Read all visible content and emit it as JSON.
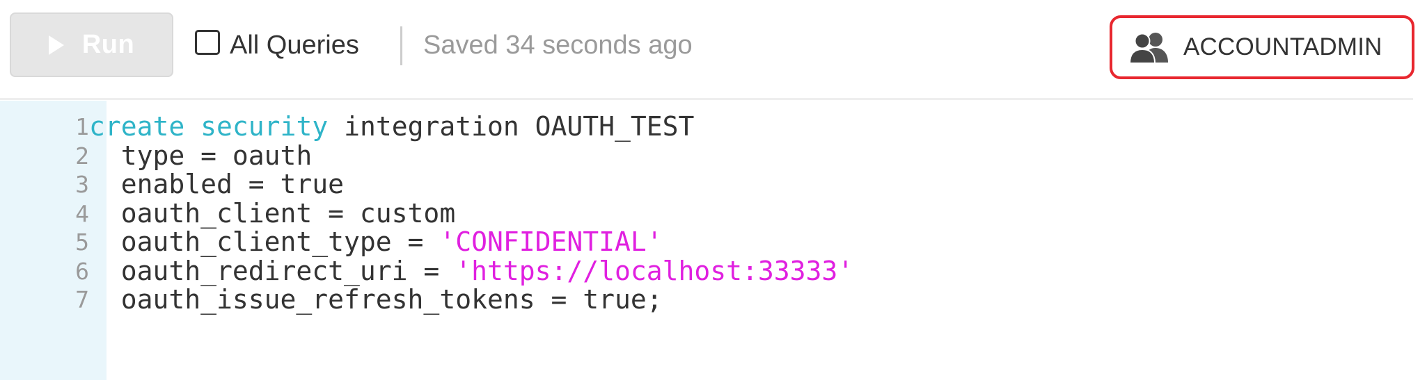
{
  "toolbar": {
    "run_label": "Run",
    "all_queries_label": "All Queries",
    "all_queries_checked": false,
    "saved_status": "Saved 34 seconds ago",
    "role_label": "ACCOUNTADMIN",
    "role_icon": "users-icon",
    "run_icon": "play-icon"
  },
  "editor": {
    "lines": [
      {
        "number": "1",
        "tokens": [
          {
            "text": "create",
            "kind": "keyword"
          },
          {
            "text": " ",
            "kind": "plain"
          },
          {
            "text": "security",
            "kind": "keyword"
          },
          {
            "text": " integration OAUTH_TEST",
            "kind": "plain"
          }
        ]
      },
      {
        "number": "2",
        "tokens": [
          {
            "text": "  type = oauth",
            "kind": "plain"
          }
        ]
      },
      {
        "number": "3",
        "tokens": [
          {
            "text": "  enabled = true",
            "kind": "plain"
          }
        ]
      },
      {
        "number": "4",
        "tokens": [
          {
            "text": "  oauth_client = custom",
            "kind": "plain"
          }
        ]
      },
      {
        "number": "5",
        "tokens": [
          {
            "text": "  oauth_client_type = ",
            "kind": "plain"
          },
          {
            "text": "'CONFIDENTIAL'",
            "kind": "string"
          }
        ]
      },
      {
        "number": "6",
        "tokens": [
          {
            "text": "  oauth_redirect_uri = ",
            "kind": "plain"
          },
          {
            "text": "'https://localhost:33333'",
            "kind": "string"
          }
        ]
      },
      {
        "number": "7",
        "tokens": [
          {
            "text": "  oauth_issue_refresh_tokens = true;",
            "kind": "plain"
          }
        ]
      }
    ]
  },
  "colors": {
    "keyword": "#2fb4c8",
    "string": "#e020e0",
    "highlight_border": "#e8272f",
    "gutter_bg": "#e9f6fb"
  }
}
